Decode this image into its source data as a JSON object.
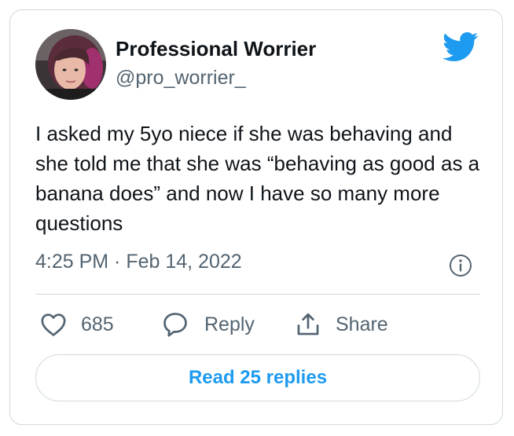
{
  "author": {
    "name": "Professional Worrier",
    "handle": "@pro_worrier_",
    "avatar_icon": "profile-photo"
  },
  "brand": {
    "icon": "twitter-bird-icon",
    "color": "#1d9bf0"
  },
  "tweet": {
    "text": "I asked my 5yo niece if she was behaving and she told me that she was “behaving as good as a banana does” and now I have so many more questions",
    "timestamp": "4:25 PM · Feb 14, 2022"
  },
  "actions": {
    "like": {
      "icon": "heart-icon",
      "count": "685"
    },
    "reply": {
      "icon": "reply-bubble-icon",
      "label": "Reply"
    },
    "share": {
      "icon": "share-icon",
      "label": "Share"
    }
  },
  "replies_button": {
    "label": "Read 25 replies"
  },
  "colors": {
    "text": "#0f1419",
    "secondary": "#536471",
    "border": "#cfd9de",
    "accent": "#1d9bf0"
  }
}
